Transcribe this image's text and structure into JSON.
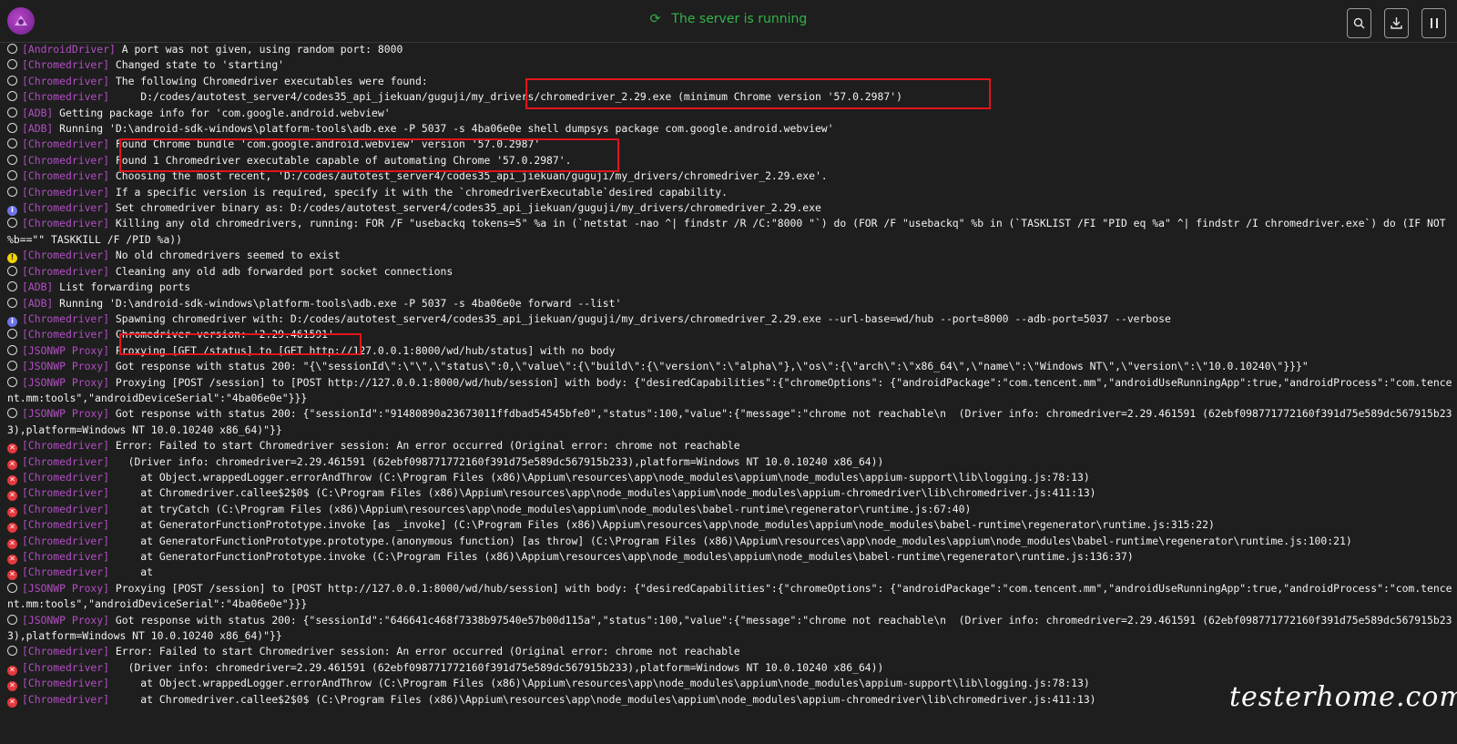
{
  "header": {
    "status": "The server is running",
    "search_icon": "search-icon",
    "download_icon": "download-icon",
    "pause_icon": "pause-icon"
  },
  "watermark": "testerhome.com",
  "colors": {
    "prefix": "#b14fc3",
    "status_green": "#33b34a",
    "highlight_box": "#e2141a",
    "info_icon": "#6f73e8",
    "warn_icon": "#f2d400",
    "error_icon": "#e4383d"
  },
  "logs": [
    {
      "level": "debug",
      "prefix": "[AndroidDriver]",
      "text": " A port was not given, using random port: 8000"
    },
    {
      "level": "debug",
      "prefix": "[Chromedriver]",
      "text": " Changed state to 'starting'"
    },
    {
      "level": "debug",
      "prefix": "[Chromedriver]",
      "text": " The following Chromedriver executables were found:"
    },
    {
      "level": "debug",
      "prefix": "[Chromedriver]",
      "text": "     D:/codes/autotest_server4/codes35_api_jiekuan/guguji/my_drivers/chromedriver_2.29.exe (minimum Chrome version '57.0.2987')"
    },
    {
      "level": "debug",
      "prefix": "[ADB]",
      "text": " Getting package info for 'com.google.android.webview'"
    },
    {
      "level": "debug",
      "prefix": "[ADB]",
      "text": " Running 'D:\\android-sdk-windows\\platform-tools\\adb.exe -P 5037 -s 4ba06e0e shell dumpsys package com.google.android.webview'"
    },
    {
      "level": "debug",
      "prefix": "[Chromedriver]",
      "text": " Found Chrome bundle 'com.google.android.webview' version '57.0.2987'"
    },
    {
      "level": "debug",
      "prefix": "[Chromedriver]",
      "text": " Found 1 Chromedriver executable capable of automating Chrome '57.0.2987'."
    },
    {
      "level": "debug",
      "prefix": "[Chromedriver]",
      "text": " Choosing the most recent, 'D:/codes/autotest_server4/codes35_api_jiekuan/guguji/my_drivers/chromedriver_2.29.exe'."
    },
    {
      "level": "debug",
      "prefix": "[Chromedriver]",
      "text": " If a specific version is required, specify it with the `chromedriverExecutable`desired capability."
    },
    {
      "level": "info",
      "prefix": "[Chromedriver]",
      "text": " Set chromedriver binary as: D:/codes/autotest_server4/codes35_api_jiekuan/guguji/my_drivers/chromedriver_2.29.exe"
    },
    {
      "level": "debug",
      "prefix": "[Chromedriver]",
      "text": " Killing any old chromedrivers, running: FOR /F \"usebackq tokens=5\" %a in (`netstat -nao ^| findstr /R /C:\"8000 \"`) do (FOR /F \"usebackq\" %b in (`TASKLIST /FI \"PID eq %a\" ^| findstr /I chromedriver.exe`) do (IF NOT %b==\"\" TASKKILL /F /PID %a))"
    },
    {
      "level": "warn",
      "prefix": "[Chromedriver]",
      "text": " No old chromedrivers seemed to exist"
    },
    {
      "level": "debug",
      "prefix": "[Chromedriver]",
      "text": " Cleaning any old adb forwarded port socket connections"
    },
    {
      "level": "debug",
      "prefix": "[ADB]",
      "text": " List forwarding ports"
    },
    {
      "level": "debug",
      "prefix": "[ADB]",
      "text": " Running 'D:\\android-sdk-windows\\platform-tools\\adb.exe -P 5037 -s 4ba06e0e forward --list'"
    },
    {
      "level": "info",
      "prefix": "[Chromedriver]",
      "text": " Spawning chromedriver with: D:/codes/autotest_server4/codes35_api_jiekuan/guguji/my_drivers/chromedriver_2.29.exe --url-base=wd/hub --port=8000 --adb-port=5037 --verbose"
    },
    {
      "level": "debug",
      "prefix": "[Chromedriver]",
      "text": " Chromedriver version: '2.29.461591'"
    },
    {
      "level": "debug",
      "prefix": "[JSONWP Proxy]",
      "text": " Proxying [GET /status] to [GET http://127.0.0.1:8000/wd/hub/status] with no body"
    },
    {
      "level": "debug",
      "prefix": "[JSONWP Proxy]",
      "text": " Got response with status 200: \"{\\\"sessionId\\\":\\\"\\\",\\\"status\\\":0,\\\"value\\\":{\\\"build\\\":{\\\"version\\\":\\\"alpha\\\"},\\\"os\\\":{\\\"arch\\\":\\\"x86_64\\\",\\\"name\\\":\\\"Windows NT\\\",\\\"version\\\":\\\"10.0.10240\\\"}}}\""
    },
    {
      "level": "debug",
      "prefix": "[JSONWP Proxy]",
      "text": " Proxying [POST /session] to [POST http://127.0.0.1:8000/wd/hub/session] with body: {\"desiredCapabilities\":{\"chromeOptions\": {\"androidPackage\":\"com.tencent.mm\",\"androidUseRunningApp\":true,\"androidProcess\":\"com.tencent.mm:tools\",\"androidDeviceSerial\":\"4ba06e0e\"}}}"
    },
    {
      "level": "debug",
      "prefix": "[JSONWP Proxy]",
      "text": " Got response with status 200: {\"sessionId\":\"91480890a23673011ffdbad54545bfe0\",\"status\":100,\"value\":{\"message\":\"chrome not reachable\\n  (Driver info: chromedriver=2.29.461591 (62ebf098771772160f391d75e589dc567915b233),platform=Windows NT 10.0.10240 x86_64)\"}}"
    },
    {
      "level": "error",
      "prefix": "[Chromedriver]",
      "text": " Error: Failed to start Chromedriver session: An error occurred (Original error: chrome not reachable"
    },
    {
      "level": "error",
      "prefix": "[Chromedriver]",
      "text": "   (Driver info: chromedriver=2.29.461591 (62ebf098771772160f391d75e589dc567915b233),platform=Windows NT 10.0.10240 x86_64))"
    },
    {
      "level": "error",
      "prefix": "[Chromedriver]",
      "text": "     at Object.wrappedLogger.errorAndThrow (C:\\Program Files (x86)\\Appium\\resources\\app\\node_modules\\appium\\node_modules\\appium-support\\lib\\logging.js:78:13)"
    },
    {
      "level": "error",
      "prefix": "[Chromedriver]",
      "text": "     at Chromedriver.callee$2$0$ (C:\\Program Files (x86)\\Appium\\resources\\app\\node_modules\\appium\\node_modules\\appium-chromedriver\\lib\\chromedriver.js:411:13)"
    },
    {
      "level": "error",
      "prefix": "[Chromedriver]",
      "text": "     at tryCatch (C:\\Program Files (x86)\\Appium\\resources\\app\\node_modules\\appium\\node_modules\\babel-runtime\\regenerator\\runtime.js:67:40)"
    },
    {
      "level": "error",
      "prefix": "[Chromedriver]",
      "text": "     at GeneratorFunctionPrototype.invoke [as _invoke] (C:\\Program Files (x86)\\Appium\\resources\\app\\node_modules\\appium\\node_modules\\babel-runtime\\regenerator\\runtime.js:315:22)"
    },
    {
      "level": "error",
      "prefix": "[Chromedriver]",
      "text": "     at GeneratorFunctionPrototype.prototype.(anonymous function) [as throw] (C:\\Program Files (x86)\\Appium\\resources\\app\\node_modules\\appium\\node_modules\\babel-runtime\\regenerator\\runtime.js:100:21)"
    },
    {
      "level": "error",
      "prefix": "[Chromedriver]",
      "text": "     at GeneratorFunctionPrototype.invoke (C:\\Program Files (x86)\\Appium\\resources\\app\\node_modules\\appium\\node_modules\\babel-runtime\\regenerator\\runtime.js:136:37)"
    },
    {
      "level": "error",
      "prefix": "[Chromedriver]",
      "text": "     at"
    },
    {
      "level": "debug",
      "prefix": "[JSONWP Proxy]",
      "text": " Proxying [POST /session] to [POST http://127.0.0.1:8000/wd/hub/session] with body: {\"desiredCapabilities\":{\"chromeOptions\": {\"androidPackage\":\"com.tencent.mm\",\"androidUseRunningApp\":true,\"androidProcess\":\"com.tencent.mm:tools\",\"androidDeviceSerial\":\"4ba06e0e\"}}}"
    },
    {
      "level": "debug",
      "prefix": "[JSONWP Proxy]",
      "text": " Got response with status 200: {\"sessionId\":\"646641c468f7338b97540e57b00d115a\",\"status\":100,\"value\":{\"message\":\"chrome not reachable\\n  (Driver info: chromedriver=2.29.461591 (62ebf098771772160f391d75e589dc567915b233),platform=Windows NT 10.0.10240 x86_64)\"}}"
    },
    {
      "level": "debug",
      "prefix": "[Chromedriver]",
      "text": " Error: Failed to start Chromedriver session: An error occurred (Original error: chrome not reachable"
    },
    {
      "level": "error",
      "prefix": "[Chromedriver]",
      "text": "   (Driver info: chromedriver=2.29.461591 (62ebf098771772160f391d75e589dc567915b233),platform=Windows NT 10.0.10240 x86_64))"
    },
    {
      "level": "error",
      "prefix": "[Chromedriver]",
      "text": "     at Object.wrappedLogger.errorAndThrow (C:\\Program Files (x86)\\Appium\\resources\\app\\node_modules\\appium\\node_modules\\appium-support\\lib\\logging.js:78:13)"
    },
    {
      "level": "error",
      "prefix": "[Chromedriver]",
      "text": "     at Chromedriver.callee$2$0$ (C:\\Program Files (x86)\\Appium\\resources\\app\\node_modules\\appium\\node_modules\\appium-chromedriver\\lib\\chromedriver.js:411:13)"
    }
  ]
}
